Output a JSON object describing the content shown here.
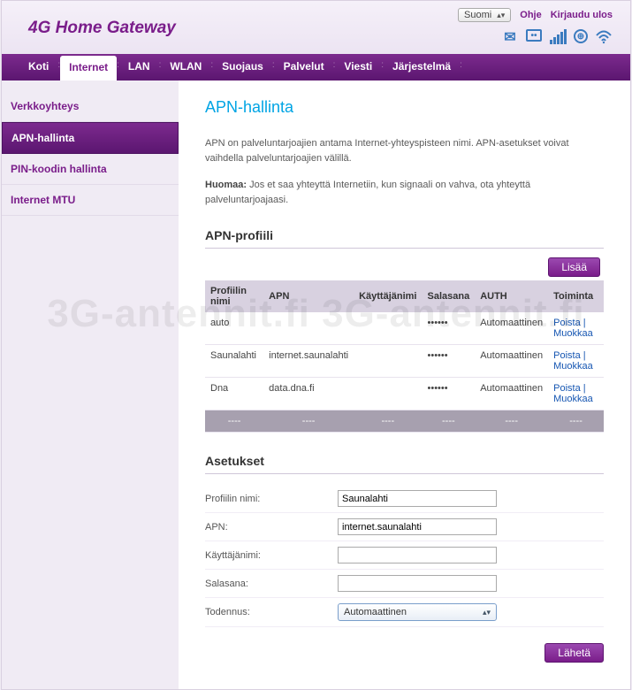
{
  "brand": "4G Home Gateway",
  "header": {
    "language": "Suomi",
    "help": "Ohje",
    "logout": "Kirjaudu ulos"
  },
  "nav": {
    "items": [
      "Koti",
      "Internet",
      "LAN",
      "WLAN",
      "Suojaus",
      "Palvelut",
      "Viesti",
      "Järjestelmä"
    ],
    "active": 1
  },
  "sidebar": {
    "items": [
      "Verkkoyhteys",
      "APN-hallinta",
      "PIN-koodin hallinta",
      "Internet MTU"
    ],
    "active": 1
  },
  "page": {
    "title": "APN-hallinta",
    "desc1": "APN on palveluntarjoajien antama Internet-yhteyspisteen nimi. APN-asetukset voivat vaihdella palveluntarjoajien välillä.",
    "notice_label": "Huomaa:",
    "notice_text": "Jos et saa yhteyttä Internetiin, kun signaali on vahva, ota yhteyttä palveluntarjoajaasi."
  },
  "profile_section": {
    "heading": "APN-profiili",
    "add_button": "Lisää",
    "headers": {
      "name": "Profiilin nimi",
      "apn": "APN",
      "user": "Käyttäjänimi",
      "pass": "Salasana",
      "auth": "AUTH",
      "action": "Toiminta"
    },
    "action_delete": "Poista",
    "action_edit": "Muokkaa",
    "rows": [
      {
        "name": "auto",
        "apn": "",
        "user": "",
        "pass": "••••••",
        "auth": "Automaattinen"
      },
      {
        "name": "Saunalahti",
        "apn": "internet.saunalahti",
        "user": "",
        "pass": "••••••",
        "auth": "Automaattinen"
      },
      {
        "name": "Dna",
        "apn": "data.dna.fi",
        "user": "",
        "pass": "••••••",
        "auth": "Automaattinen"
      }
    ],
    "blank": "----"
  },
  "settings_section": {
    "heading": "Asetukset",
    "labels": {
      "name": "Profiilin nimi:",
      "apn": "APN:",
      "user": "Käyttäjänimi:",
      "pass": "Salasana:",
      "auth": "Todennus:"
    },
    "values": {
      "name": "Saunalahti",
      "apn": "internet.saunalahti",
      "user": "",
      "pass": "",
      "auth": "Automaattinen"
    },
    "submit": "Lähetä"
  },
  "watermark": "3G-antennit.fi 3G-antennit.fi"
}
